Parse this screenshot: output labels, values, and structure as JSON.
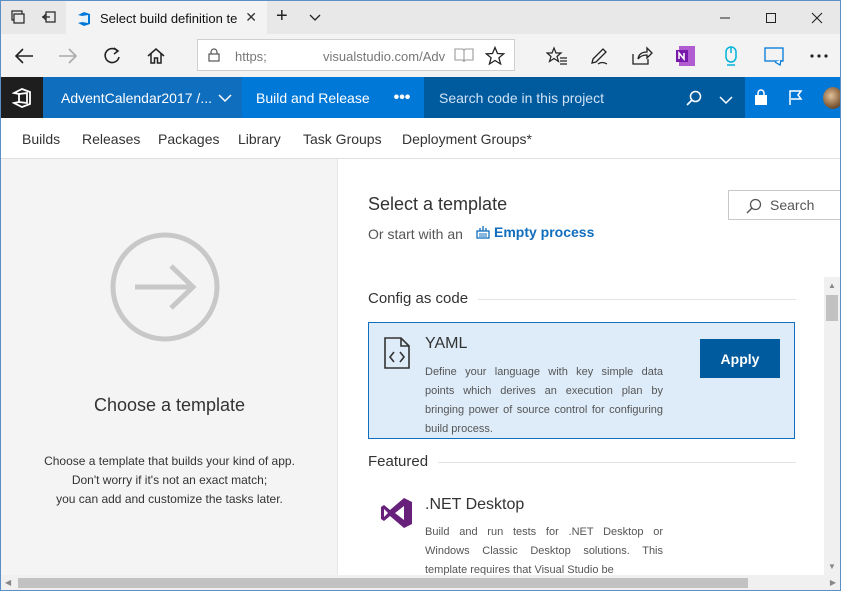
{
  "browser": {
    "tab_title": "Select build definition te",
    "url_prefix": "https;",
    "url_visible": "visualstudio.com/Adv"
  },
  "header": {
    "project": "AdventCalendar2017 /...",
    "active_hub": "Build and Release",
    "more": "•••",
    "search_placeholder": "Search code in this project"
  },
  "subnav": {
    "items": [
      "Builds",
      "Releases",
      "Packages",
      "Library",
      "Task Groups",
      "Deployment Groups*"
    ]
  },
  "left": {
    "title": "Choose a template",
    "desc_line1": "Choose a template that builds your kind of app.",
    "desc_line2": "Don't worry if it's not an exact match;",
    "desc_line3": "you can add and customize the tasks later."
  },
  "right": {
    "title": "Select a template",
    "or_start": "Or start with an",
    "empty_process": "Empty process",
    "search_label": "Search",
    "section_config": "Config as code",
    "section_featured": "Featured",
    "yaml": {
      "title": "YAML",
      "desc": "Define your language with key simple data points which derives an execution plan by bringing power of source control for configuring build process.",
      "apply": "Apply"
    },
    "net_desktop": {
      "title": ".NET Desktop",
      "desc": "Build and run tests for .NET Desktop or Windows Classic Desktop solutions. This template requires that Visual Studio be"
    }
  },
  "colors": {
    "accent": "#0078d7",
    "accent_dark": "#005a9e",
    "selected_card": "#deecf9"
  }
}
